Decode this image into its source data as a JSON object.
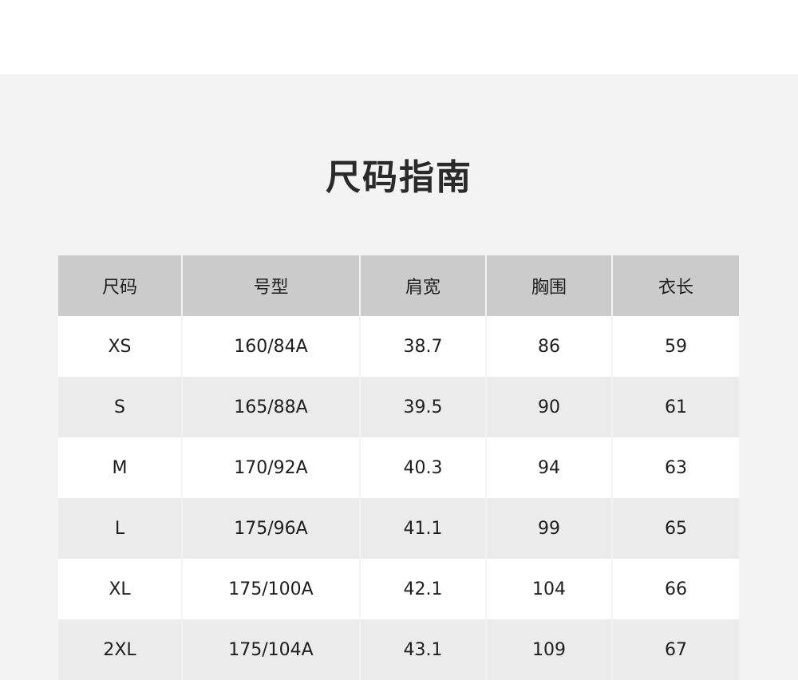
{
  "title": "尺码指南",
  "colors": {
    "panel_background": "#f3f3f3",
    "header_background": "#cbcbcb",
    "row_light": "#ffffff",
    "row_dark": "#ebebeb"
  },
  "table": {
    "headers": [
      "尺码",
      "号型",
      "肩宽",
      "胸围",
      "衣长"
    ],
    "rows": [
      [
        "XS",
        "160/84A",
        "38.7",
        "86",
        "59"
      ],
      [
        "S",
        "165/88A",
        "39.5",
        "90",
        "61"
      ],
      [
        "M",
        "170/92A",
        "40.3",
        "94",
        "63"
      ],
      [
        "L",
        "175/96A",
        "41.1",
        "99",
        "65"
      ],
      [
        "XL",
        "175/100A",
        "42.1",
        "104",
        "66"
      ],
      [
        "2XL",
        "175/104A",
        "43.1",
        "109",
        "67"
      ]
    ]
  }
}
